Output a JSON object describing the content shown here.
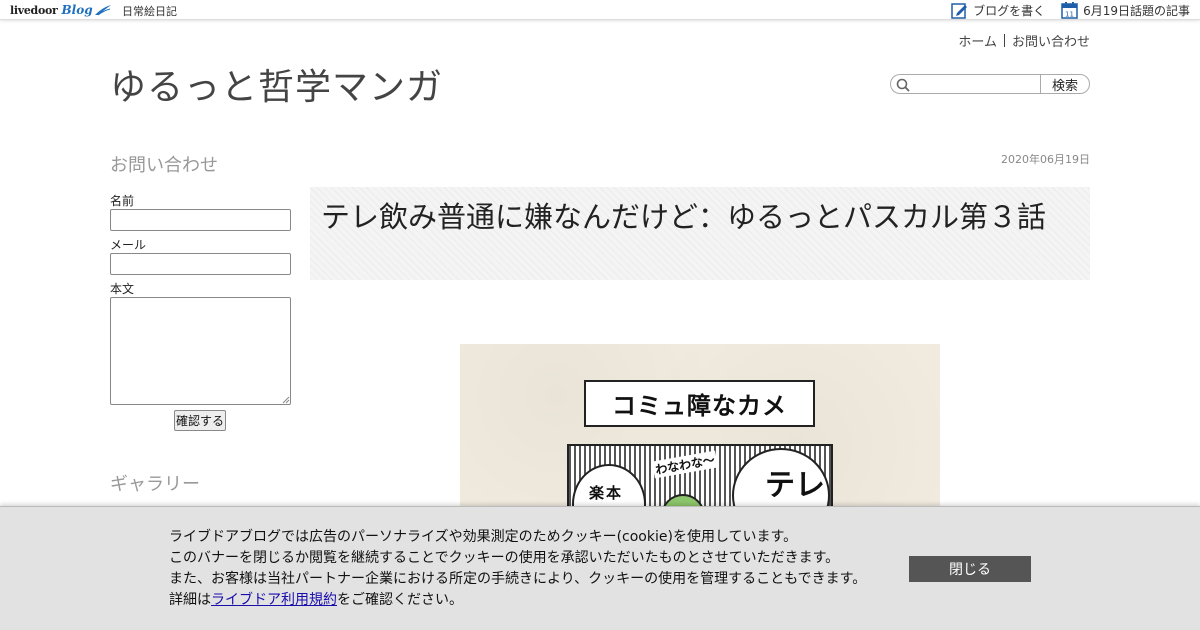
{
  "topbar": {
    "brand_left": "livedoor",
    "brand_right": "Blog",
    "category": "日常絵日記",
    "write_link": "ブログを書く",
    "calendar_day": "11",
    "topic_link": "6月19日話題の記事"
  },
  "header": {
    "nav": [
      "ホーム",
      "お問い合わせ"
    ],
    "blog_title": "ゆるっと哲学マンガ",
    "search": {
      "placeholder": "",
      "button": "検索"
    }
  },
  "sidebar": {
    "contact": {
      "heading": "お問い合わせ",
      "name_label": "名前",
      "email_label": "メール",
      "body_label": "本文",
      "submit": "確認する"
    },
    "gallery": {
      "heading": "ギャラリー"
    }
  },
  "article": {
    "date": "2020年06月19日",
    "title": "テレ飲み普通に嫌なんだけど：ゆるっとパスカル第３話",
    "comic": {
      "caption": "コミュ障なカメ",
      "bubble_left": "楽本",
      "bubble_right": "テレ",
      "sfx": "わなわな〜",
      "colors": {
        "paper": "#f1ebdf",
        "character": "#8cc56b"
      }
    }
  },
  "cookie_banner": {
    "line1": "ライブドアブログでは広告のパーソナライズや効果測定のためクッキー(cookie)を使用しています。",
    "line2": "このバナーを閉じるか閲覧を継続することでクッキーの使用を承認いただいたものとさせていただきます。",
    "line3": "また、お客様は当社パートナー企業における所定の手続きにより、クッキーの使用を管理することもできます。",
    "line4_prefix": "詳細は",
    "line4_link": "ライブドア利用規約",
    "line4_suffix": "をご確認ください。",
    "close_button": "閉じる"
  },
  "icons": {
    "write": "pencil-note-icon",
    "calendar": "calendar-icon",
    "search": "magnifier-icon"
  },
  "colors": {
    "brand_blue": "#1f6fbf",
    "link": "#1a0dab",
    "close_button": "#555555",
    "banner_bg": "#e2e2e2"
  }
}
